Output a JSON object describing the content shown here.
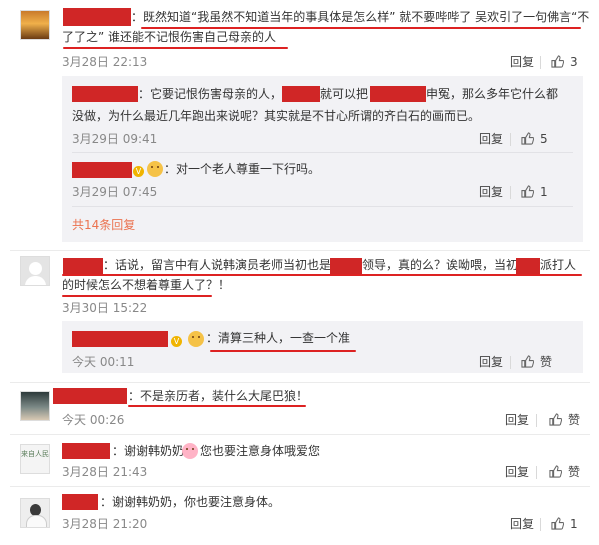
{
  "colors": {
    "redaction": "#d02626",
    "username": "#eb7350",
    "underline": "#d22222",
    "reply_bg": "#f2f2f5"
  },
  "actions": {
    "reply": "回复",
    "like": "赞"
  },
  "comments": [
    {
      "line1": "：既然知道“我虽然不知道当年的事具体是怎么样” 就不要哔哔了 吴欢引了一句佛言“不",
      "line2": "了了之”    谁还能不记恨伤害自己母亲的人",
      "time": "3月28日 22:13",
      "likes": "3"
    },
    {
      "line1": "：话说，留言中有人说韩演员老师当初也是",
      "line1b": "领导，真的么？诶呦喂，当初",
      "line1c": "派打人",
      "line2": "的时候怎么不想着尊重人了？！",
      "time": "3月30日 15:22"
    },
    {
      "line1": "：不是亲历者，装什么大尾巴狼！",
      "time": "今天 00:26"
    },
    {
      "line1": "：谢谢韩奶奶",
      "line1b": "您也要注意身体哦爱您",
      "time": "3月28日 21:43",
      "avatar_text": "来自人民"
    },
    {
      "line1": "：谢谢韩奶奶，你也要注意身体。",
      "time": "3月28日 21:20",
      "likes": "1"
    }
  ],
  "replies": [
    {
      "line1a": "：它要记恨伤害母亲的人，",
      "line1b": "就可以把",
      "line1c": "申冤，那么多年它什么都",
      "line2": "没做，为什么最近几年跑出来说呢？其实就是不甘心所谓的齐白石的画而已。",
      "time": "3月29日 09:41",
      "likes": "5"
    },
    {
      "line1": "：对一个老人尊重一下行吗。",
      "time": "3月29日 07:45",
      "likes": "1"
    },
    {
      "line1": "：清算三种人，一查一个准",
      "time": "今天 00:11"
    }
  ],
  "more_replies": "共14条回复"
}
